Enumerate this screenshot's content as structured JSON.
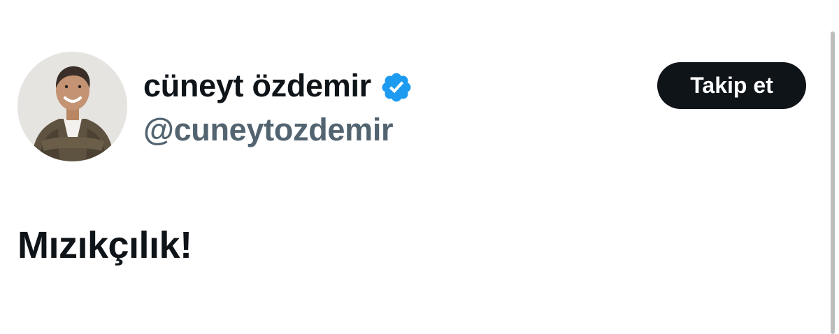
{
  "author": {
    "display_name": "cüneyt özdemir",
    "handle": "@cuneytozdemir",
    "verified": true,
    "verified_color": "#1d9bf0",
    "avatar_icon": "profile-photo"
  },
  "actions": {
    "follow_label": "Takip et"
  },
  "tweet": {
    "text": "Mızıkçılık!"
  },
  "colors": {
    "text_primary": "#0f1419",
    "text_secondary": "#536471",
    "button_bg": "#0f1419",
    "button_text": "#ffffff",
    "background": "#ffffff"
  }
}
